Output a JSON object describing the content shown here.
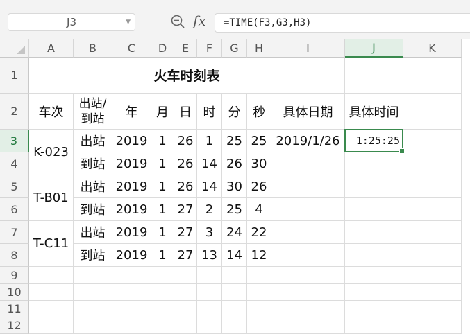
{
  "name_box": {
    "value": "J3"
  },
  "formula_bar": {
    "formula": "=TIME(F3,G3,H3)",
    "fx_label": "fx"
  },
  "columns": [
    "A",
    "B",
    "C",
    "D",
    "E",
    "F",
    "G",
    "H",
    "I",
    "J",
    "K"
  ],
  "rows": [
    "1",
    "2",
    "3",
    "4",
    "5",
    "6",
    "7",
    "8",
    "9",
    "10",
    "11",
    "12"
  ],
  "selected": {
    "column": "J",
    "row": "3"
  },
  "sheet": {
    "title": "火车时刻表",
    "headers": {
      "train": "车次",
      "type": "出站/到站",
      "year": "年",
      "month": "月",
      "day": "日",
      "hour": "时",
      "minute": "分",
      "second": "秒",
      "date": "具体日期",
      "time": "具体时间"
    },
    "trains": [
      {
        "name": "K-023",
        "rows": [
          {
            "type": "出站",
            "year": "2019",
            "month": "1",
            "day": "26",
            "hour": "1",
            "minute": "25",
            "second": "25",
            "date": "2019/1/26",
            "time": "1:25:25"
          },
          {
            "type": "到站",
            "year": "2019",
            "month": "1",
            "day": "26",
            "hour": "14",
            "minute": "26",
            "second": "30",
            "date": "",
            "time": ""
          }
        ]
      },
      {
        "name": "T-B01",
        "rows": [
          {
            "type": "出站",
            "year": "2019",
            "month": "1",
            "day": "26",
            "hour": "14",
            "minute": "30",
            "second": "26",
            "date": "",
            "time": ""
          },
          {
            "type": "到站",
            "year": "2019",
            "month": "1",
            "day": "27",
            "hour": "2",
            "minute": "25",
            "second": "4",
            "date": "",
            "time": ""
          }
        ]
      },
      {
        "name": "T-C11",
        "rows": [
          {
            "type": "出站",
            "year": "2019",
            "month": "1",
            "day": "27",
            "hour": "3",
            "minute": "24",
            "second": "22",
            "date": "",
            "time": ""
          },
          {
            "type": "到站",
            "year": "2019",
            "month": "1",
            "day": "27",
            "hour": "13",
            "minute": "14",
            "second": "12",
            "date": "",
            "time": ""
          }
        ]
      }
    ]
  },
  "colors": {
    "selection": "#3a8a4e",
    "header_bg": "#f3f3f3",
    "grid": "#dcdcdc"
  }
}
